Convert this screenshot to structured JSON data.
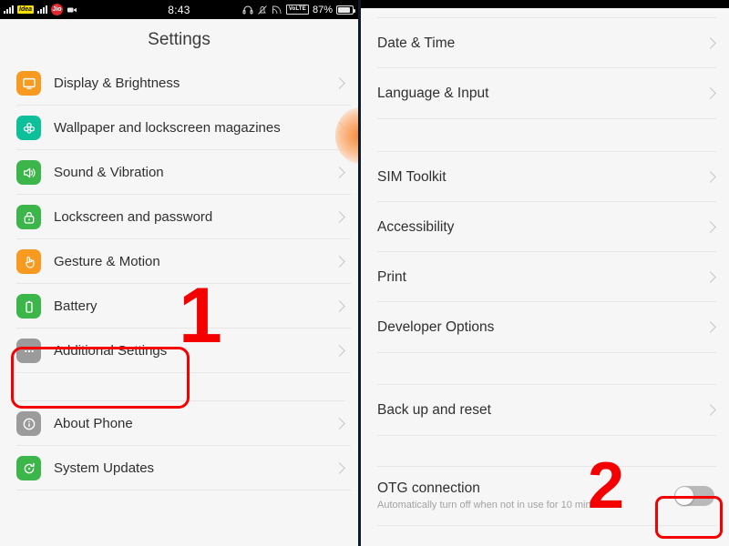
{
  "statusbar": {
    "time": "8:43",
    "battery_percent": "87%",
    "carrier_1": "Idea",
    "carrier_2": "Jio",
    "volte_label": "VoLTE",
    "icons": [
      "signal-bars-icon",
      "idea-logo-icon",
      "signal-bars-icon",
      "jio-logo-icon",
      "video-camera-icon",
      "headphones-icon",
      "mute-bell-icon",
      "cast-icon",
      "volte-badge-icon",
      "battery-icon"
    ]
  },
  "left_panel": {
    "title": "Settings",
    "groups": [
      {
        "items": [
          {
            "label": "Display & Brightness",
            "icon": "display-icon",
            "color": "#f79a1f"
          },
          {
            "label": "Wallpaper and lockscreen magazines",
            "icon": "flower-icon",
            "color": "#0ec09a"
          },
          {
            "label": "Sound & Vibration",
            "icon": "speaker-icon",
            "color": "#3cb54a"
          },
          {
            "label": "Lockscreen and password",
            "icon": "lock-icon",
            "color": "#3cb54a"
          },
          {
            "label": "Gesture & Motion",
            "icon": "hand-gesture-icon",
            "color": "#f79a1f"
          },
          {
            "label": "Battery",
            "icon": "battery-icon",
            "color": "#3cb54a"
          },
          {
            "label": "Additional Settings",
            "icon": "ellipsis-icon",
            "color": "#9b9b9b"
          }
        ]
      },
      {
        "items": [
          {
            "label": "About Phone",
            "icon": "info-icon",
            "color": "#9b9b9b"
          },
          {
            "label": "System Updates",
            "icon": "update-icon",
            "color": "#3cb54a"
          }
        ]
      }
    ]
  },
  "right_panel": {
    "groups": [
      {
        "items": [
          {
            "label": "Date & Time"
          },
          {
            "label": "Language & Input"
          }
        ]
      },
      {
        "items": [
          {
            "label": "SIM Toolkit"
          },
          {
            "label": "Accessibility"
          },
          {
            "label": "Print"
          },
          {
            "label": "Developer Options"
          }
        ]
      },
      {
        "items": [
          {
            "label": "Back up and reset"
          }
        ]
      },
      {
        "items": [
          {
            "label": "OTG connection",
            "sublabel": "Automatically turn off when not in use for 10 minutes",
            "toggle": "off"
          }
        ]
      }
    ]
  },
  "annotations": {
    "step_one": "1",
    "step_two": "2",
    "highlight_color": "#f50000"
  }
}
